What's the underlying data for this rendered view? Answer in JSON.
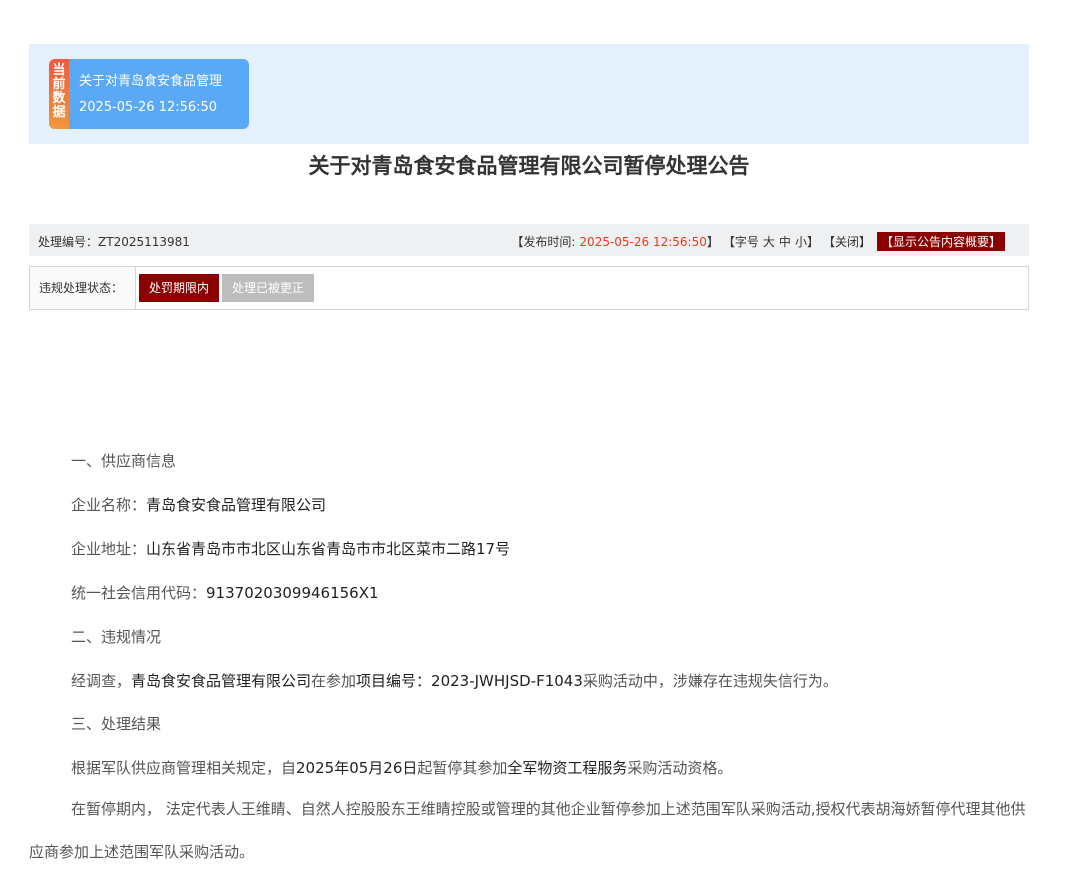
{
  "current": {
    "tag": "当前数据",
    "title": "关于对青岛食安食品管理",
    "time": "2025-05-26 12:56:50"
  },
  "title": "关于对青岛食安食品管理有限公司暂停处理公告",
  "info": {
    "number_label": "处理编号：",
    "number": "ZT2025113981",
    "publish_label": "【发布时间:",
    "publish_time": "2025-05-26 12:56:50",
    "publish_end": "】",
    "font_label": "【字号",
    "font_large": "大",
    "font_mid": "中",
    "font_small": "小",
    "font_end": "】",
    "close": "【关闭】",
    "summary": "【显示公告内容概要】"
  },
  "status": {
    "label": "违规处理状态：",
    "current": "处罚期限内",
    "corrected": "处理已被更正"
  },
  "content": {
    "s1_heading": "一、供应商信息",
    "company_label": "企业名称：",
    "company_name": "青岛食安食品管理有限公司",
    "address_label": "企业地址：",
    "address": "山东省青岛市市北区山东省青岛市市北区菜市二路17号",
    "credit_label": "统一社会信用代码：",
    "credit_code": "9137020309946156X1",
    "s2_heading": "二、违规情况",
    "v_pre": "经调查，",
    "v_company": "青岛食安食品管理有限公司",
    "v_mid": "在参加",
    "v_project": "项目编号：2023-JWHJSD-F1043",
    "v_end": "采购活动中，涉嫌存在违规失信行为。",
    "s3_heading": "三、处理结果",
    "r_pre": "根据军队供应商管理相关规定，自",
    "r_date": "2025年05月26日",
    "r_mid": "起暂停其参加",
    "r_scope": "全军物资工程服务",
    "r_end": "采购活动资格。",
    "r_para2": "在暂停期内， 法定代表人王维睛、自然人控股股东王维睛控股或管理的其他企业暂停参加上述范围军队采购活动,授权代表胡海娇暂停代理其他供应商参加上述范围军队采购活动。"
  }
}
